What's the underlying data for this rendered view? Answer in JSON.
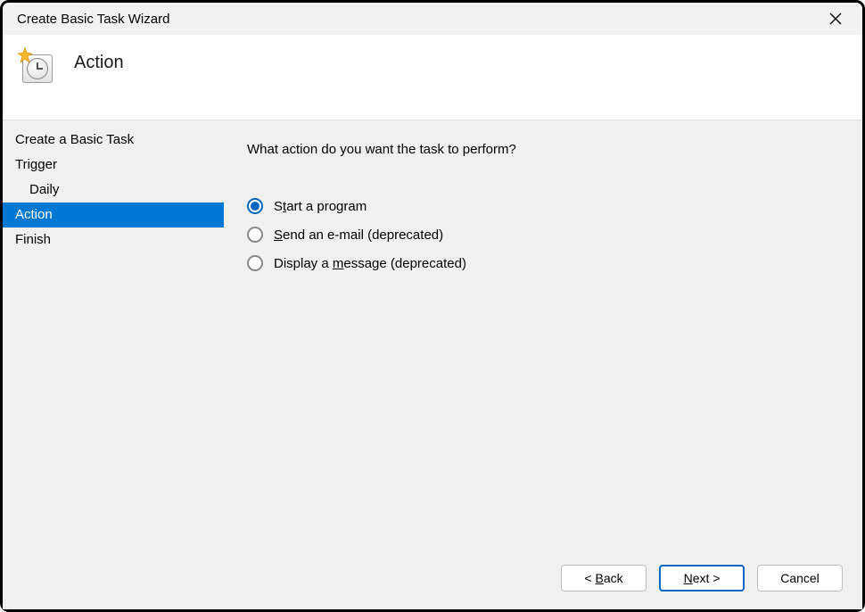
{
  "window": {
    "title": "Create Basic Task Wizard"
  },
  "header": {
    "title": "Action"
  },
  "sidebar": {
    "items": [
      {
        "label": "Create a Basic Task",
        "indent": false,
        "selected": false
      },
      {
        "label": "Trigger",
        "indent": false,
        "selected": false
      },
      {
        "label": "Daily",
        "indent": true,
        "selected": false
      },
      {
        "label": "Action",
        "indent": false,
        "selected": true
      },
      {
        "label": "Finish",
        "indent": false,
        "selected": false
      }
    ]
  },
  "content": {
    "prompt": "What action do you want the task to perform?",
    "options": [
      {
        "label_pre": "S",
        "label_key": "t",
        "label_post": "art a program",
        "checked": true
      },
      {
        "label_pre": "",
        "label_key": "S",
        "label_post": "end an e-mail (deprecated)",
        "checked": false
      },
      {
        "label_pre": "Display a ",
        "label_key": "m",
        "label_post": "essage (deprecated)",
        "checked": false
      }
    ]
  },
  "footer": {
    "back_pre": "< ",
    "back_key": "B",
    "back_post": "ack",
    "next_key": "N",
    "next_post": "ext >",
    "cancel": "Cancel"
  }
}
